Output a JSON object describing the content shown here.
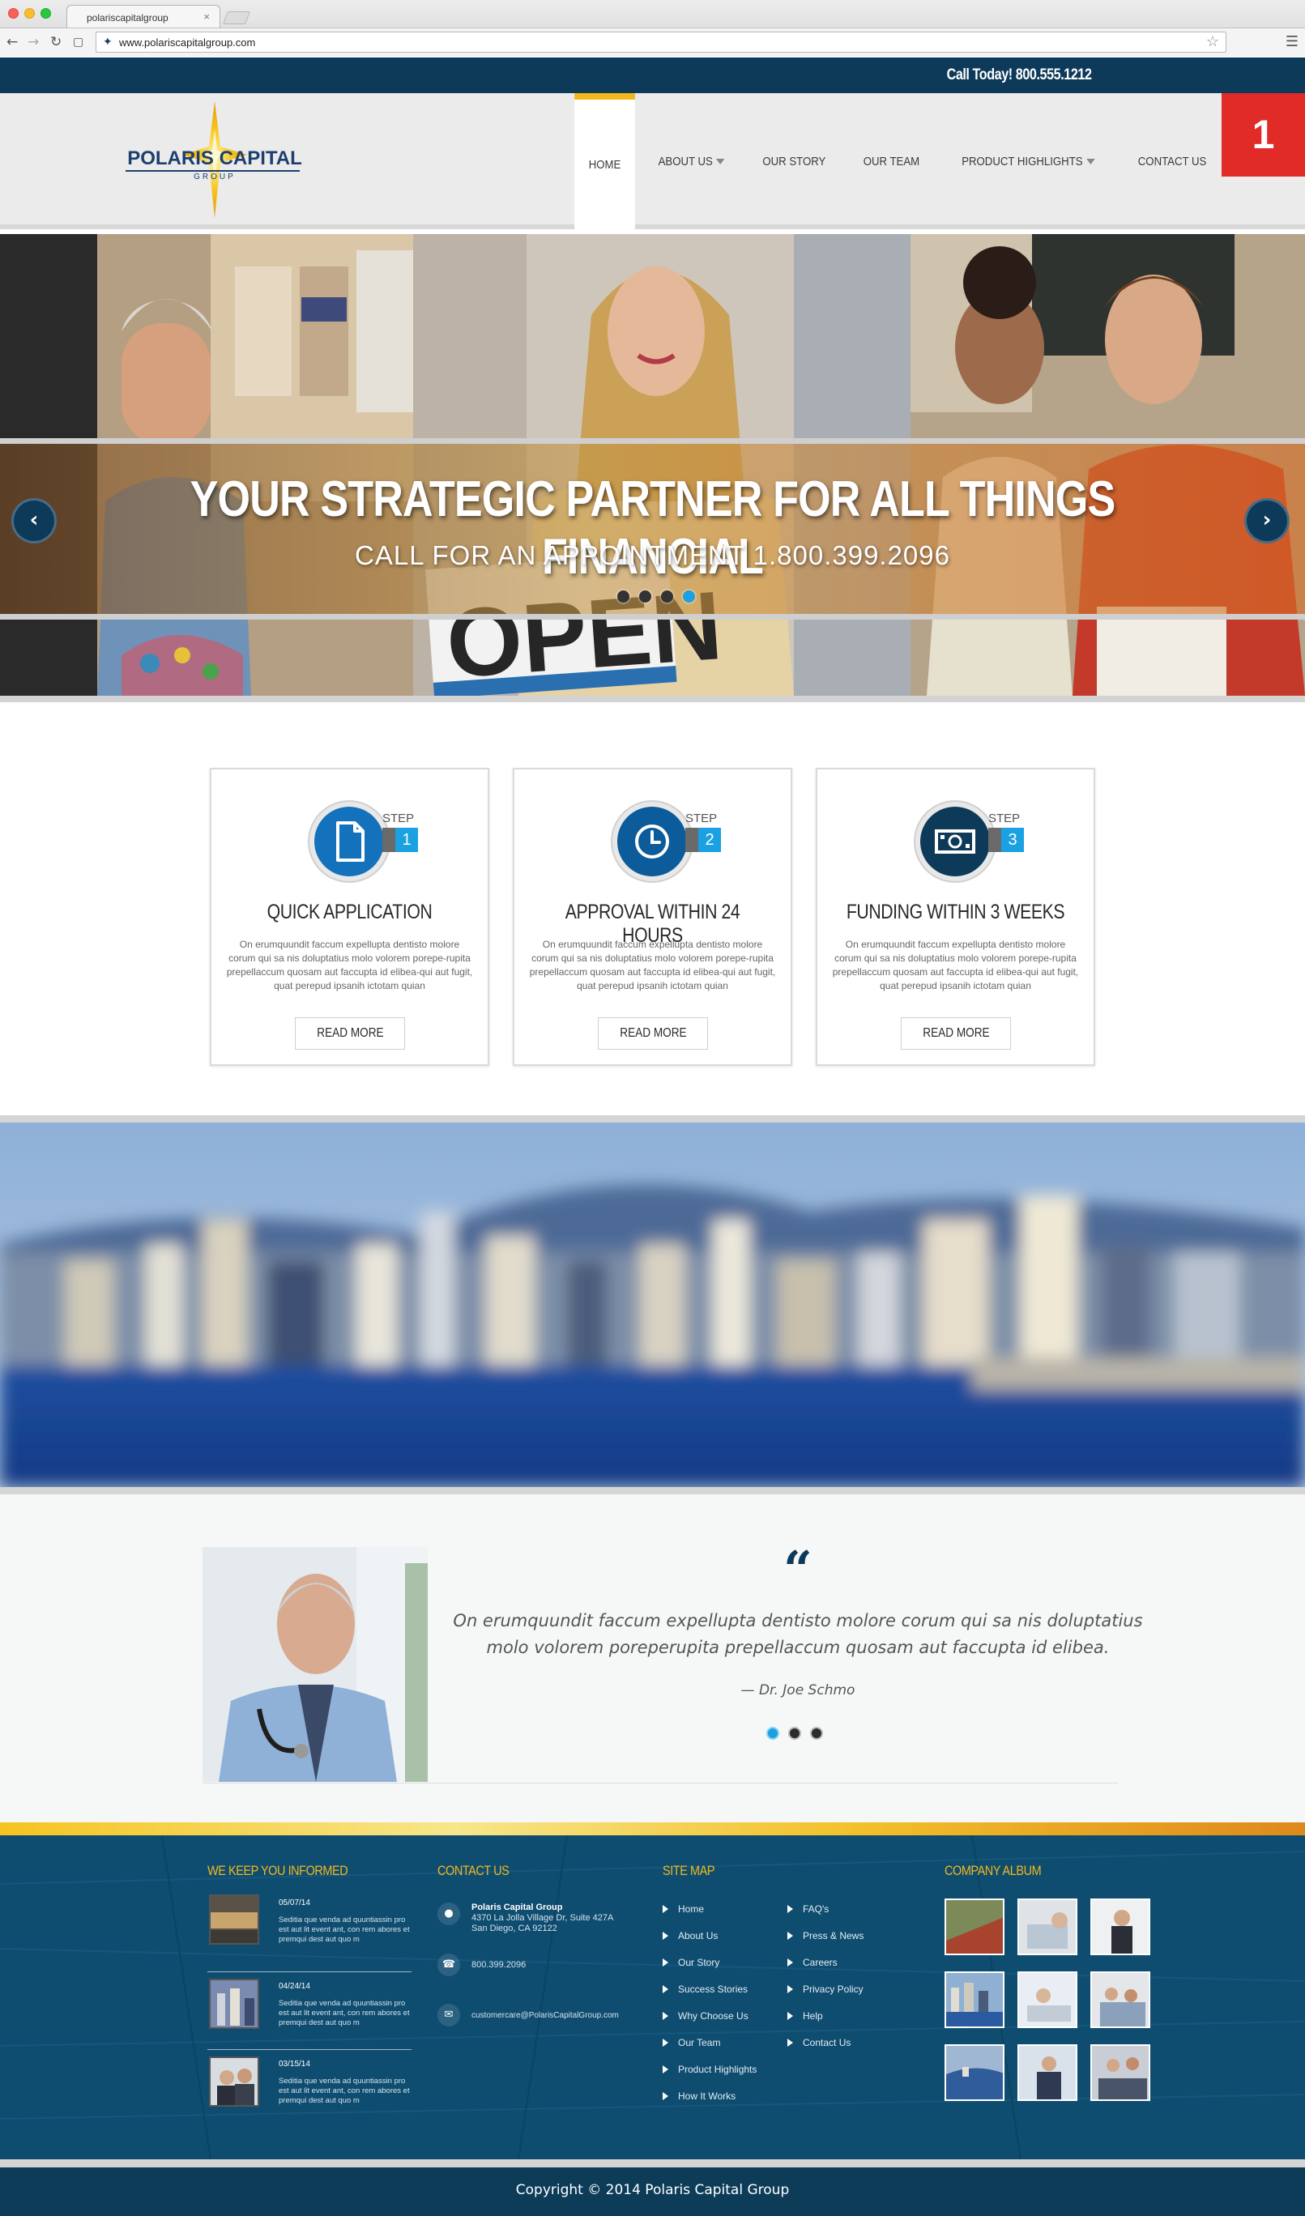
{
  "browser": {
    "tab_title": "polariscapitalgroup",
    "tab_close": "×",
    "url": "www.polariscapitalgroup.com",
    "icons": {
      "back": "back-arrow-icon",
      "forward": "forward-arrow-icon",
      "reload": "reload-icon",
      "home": "home-icon",
      "bookmark": "star-icon",
      "menu": "hamburger-menu-icon"
    }
  },
  "topbar": {
    "call_text": "Call Today! 800.555.1212"
  },
  "header": {
    "logo": {
      "word1": "POLARIS",
      "word2": "CAPITAL",
      "word3": "GROUP"
    },
    "nav": [
      {
        "label": "HOME",
        "active": true,
        "dropdown": false
      },
      {
        "label": "ABOUT US",
        "active": false,
        "dropdown": true
      },
      {
        "label": "OUR STORY",
        "active": false,
        "dropdown": false
      },
      {
        "label": "OUR TEAM",
        "active": false,
        "dropdown": false
      },
      {
        "label": "PRODUCT HIGHLIGHTS",
        "active": false,
        "dropdown": true
      },
      {
        "label": "CONTACT US",
        "active": false,
        "dropdown": false
      }
    ],
    "corner_badge": "1"
  },
  "hero": {
    "title": "YOUR STRATEGIC PARTNER FOR ALL THINGS FINANCIAL",
    "subtitle": "CALL FOR AN APPOINTMENT 1.800.399.2096",
    "sign_text": "OPEN",
    "slides_total": 4,
    "active_slide": 4,
    "prev_label": "‹",
    "next_label": "›"
  },
  "steps": [
    {
      "tag": "STEP",
      "number": "1",
      "icon": "document-icon",
      "title": "QUICK APPLICATION",
      "text": "On erumquundit faccum expellupta dentisto molore corum qui sa nis doluptatius molo volorem porepe-rupita prepellaccum quosam aut faccupta id elibea-qui aut fugit, quat perepud ipsanih ictotam quian",
      "button": "READ MORE"
    },
    {
      "tag": "STEP",
      "number": "2",
      "icon": "clock-icon",
      "title": "APPROVAL WITHIN 24 HOURS",
      "text": "On erumquundit faccum expellupta dentisto molore corum qui sa nis doluptatius molo volorem porepe-rupita prepellaccum quosam aut faccupta id elibea-qui aut fugit, quat perepud ipsanih ictotam quian",
      "button": "READ MORE"
    },
    {
      "tag": "STEP",
      "number": "3",
      "icon": "banknote-icon",
      "title": "FUNDING WITHIN 3 WEEKS",
      "text": "On erumquundit faccum expellupta dentisto molore corum qui sa nis doluptatius molo volorem porepe-rupita prepellaccum quosam aut faccupta id elibea-qui aut fugit, quat perepud ipsanih ictotam quian",
      "button": "READ MORE"
    }
  ],
  "testimonial": {
    "quote_mark": "“",
    "quote": "On erumquundit faccum expellupta dentisto molore corum qui sa nis doluptatius molo volorem poreperupita prepellaccum quosam aut faccupta id elibea.",
    "author": "— Dr. Joe Schmo",
    "slides_total": 3,
    "active_slide": 1
  },
  "footer": {
    "news_title": "WE KEEP YOU INFORMED",
    "news": [
      {
        "date": "05/07/14",
        "text": "Seditia que venda ad quuntiassin pro est aut lit event ant, con rem abores et premqui dest aut quo m"
      },
      {
        "date": "04/24/14",
        "text": "Seditia que venda ad quuntiassin pro est aut lit event ant, con rem abores et premqui dest aut quo m"
      },
      {
        "date": "03/15/14",
        "text": "Seditia que venda ad quuntiassin pro est aut lit event ant, con rem abores et premqui dest aut quo m"
      }
    ],
    "contact_title": "CONTACT US",
    "contact": {
      "company": "Polaris Capital Group",
      "address1": "4370 La Jolla Village Dr, Suite 427A",
      "address2": "San Diego, CA 92122",
      "phone": "800.399.2096",
      "email": "customercare@PolarisCapitalGroup.com"
    },
    "sitemap_title": "SITE MAP",
    "sitemap_col1": [
      "Home",
      "About Us",
      "Our Story",
      "Success Stories",
      "Why Choose Us",
      "Our Team",
      "Product Highlights",
      "How It Works"
    ],
    "sitemap_col2": [
      "FAQ's",
      "Press & News",
      "Careers",
      "Privacy Policy",
      "Help",
      "Contact Us"
    ],
    "album_title": "COMPANY ALBUM",
    "copyright": "Copyright © 2014 Polaris Capital Group"
  },
  "colors": {
    "navy": "#0e3a5a",
    "accent_blue": "#1ba0e2",
    "gold": "#f2b71d",
    "badge_red": "#e02b27",
    "footer_blue": "#0f4d70"
  }
}
